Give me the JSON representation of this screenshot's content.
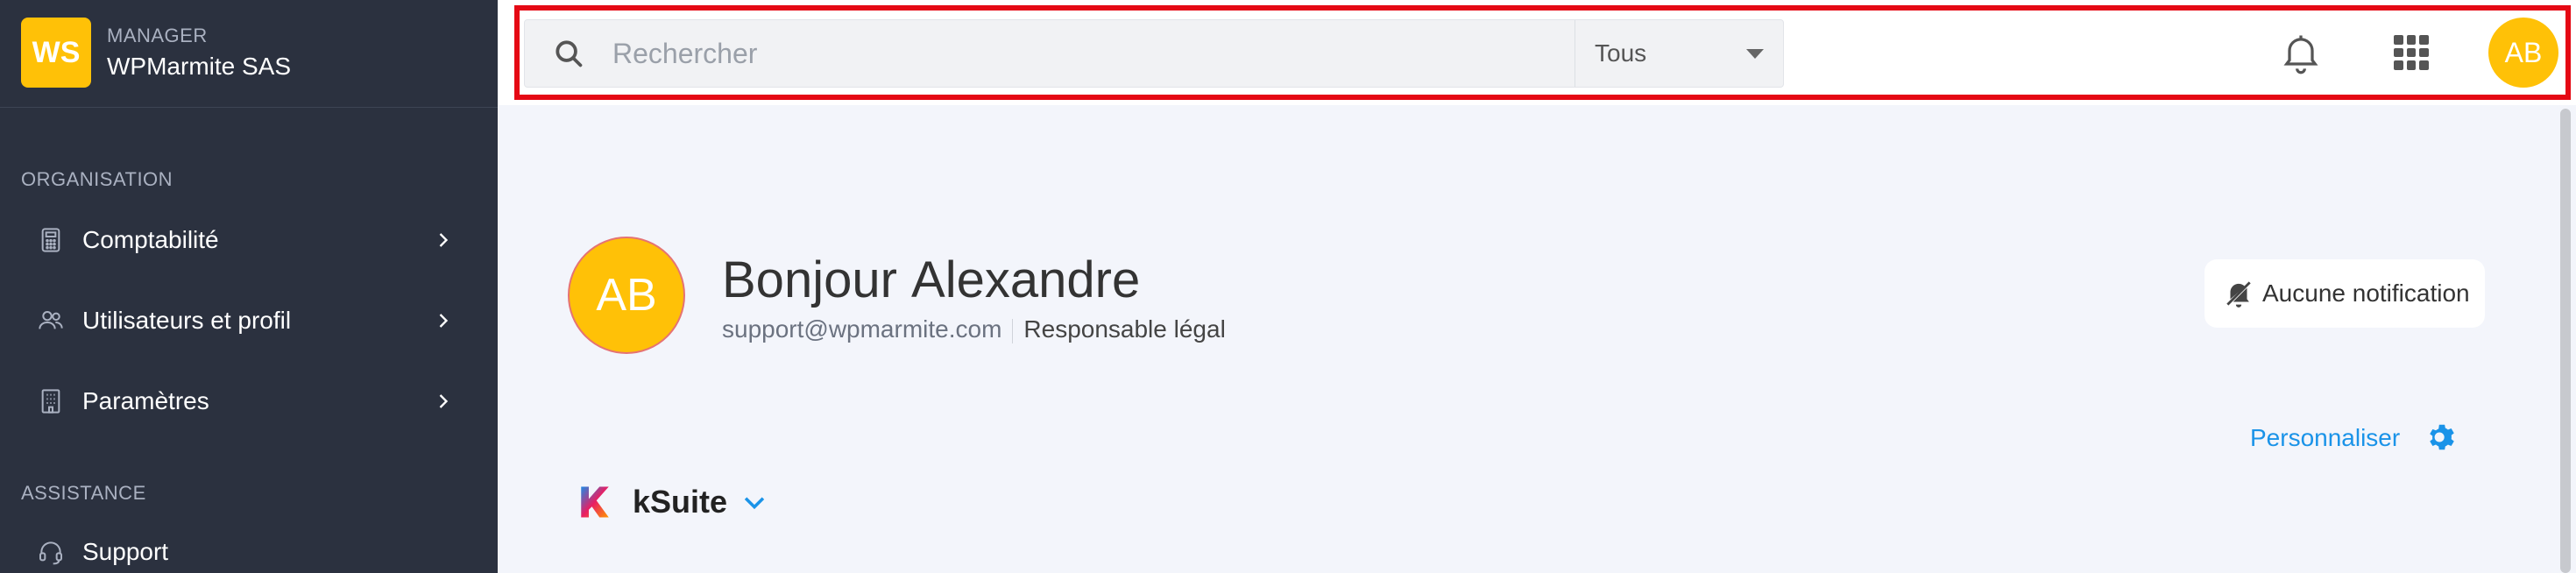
{
  "brand": {
    "initials": "WS",
    "role": "MANAGER",
    "name": "WPMarmite SAS",
    "color": "#ffc107"
  },
  "sidebar": {
    "sections": [
      {
        "title": "ORGANISATION"
      },
      {
        "title": "ASSISTANCE"
      }
    ],
    "items": [
      {
        "label": "Comptabilité",
        "icon": "calculator-icon"
      },
      {
        "label": "Utilisateurs et profil",
        "icon": "users-icon"
      },
      {
        "label": "Paramètres",
        "icon": "building-icon"
      },
      {
        "label": "Support",
        "icon": "headset-icon"
      }
    ]
  },
  "search": {
    "placeholder": "Rechercher",
    "scope": "Tous"
  },
  "topbar": {
    "avatar": "AB"
  },
  "profile": {
    "initials": "AB",
    "greeting_prefix": "Bonjour",
    "name": "Alexandre",
    "email": "support@wpmarmite.com",
    "role": "Responsable légal"
  },
  "notifications": {
    "label": "Aucune notification"
  },
  "customize": {
    "label": "Personnaliser"
  },
  "ksuite": {
    "label": "kSuite"
  },
  "colors": {
    "accent": "#1a93e8",
    "sidebar": "#2b313f",
    "highlight": "#e50914"
  }
}
